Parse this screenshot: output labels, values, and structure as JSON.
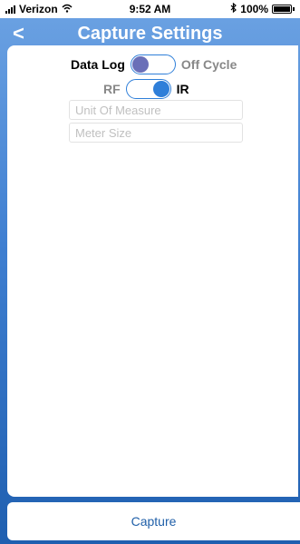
{
  "status_bar": {
    "carrier": "Verizon",
    "time": "9:52 AM",
    "battery": "100%"
  },
  "nav": {
    "back_glyph": "<",
    "title": "Capture Settings"
  },
  "toggles": {
    "mode": {
      "left_label": "Data Log",
      "right_label": "Off Cycle",
      "selected": "Data Log"
    },
    "source": {
      "left_label": "RF",
      "right_label": "IR",
      "selected": "IR"
    }
  },
  "fields": {
    "unit_of_measure": {
      "placeholder": "Unit Of Measure",
      "value": ""
    },
    "meter_size": {
      "placeholder": "Meter Size",
      "value": ""
    }
  },
  "footer": {
    "capture_label": "Capture"
  },
  "colors": {
    "accent": "#2f7fd9",
    "knob_mode": "#6a6fb8",
    "button_text": "#1f5fa8"
  },
  "icons": {
    "signal": "signal-bars-icon",
    "wifi": "wifi-icon",
    "bluetooth": "bluetooth-icon",
    "battery": "battery-icon",
    "back": "chevron-left-icon"
  }
}
